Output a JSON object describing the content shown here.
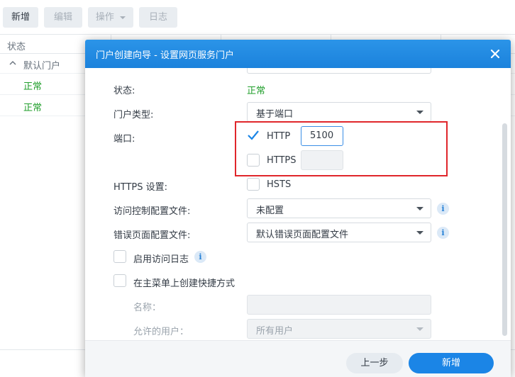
{
  "toolbar": {
    "create": "新增",
    "edit": "编辑",
    "action": "操作",
    "log": "日志"
  },
  "grid": {
    "col_status": "状态",
    "group_default": "默认门户",
    "rows": [
      "正常",
      "正常"
    ]
  },
  "dialog": {
    "title": "门户创建向导 - 设置网页服务门户",
    "fields": {
      "status_label": "状态:",
      "status_value": "正常",
      "portal_type_label": "门户类型:",
      "portal_type_value": "基于端口",
      "port_label": "端口:",
      "http_label": "HTTP",
      "http_checked": true,
      "http_port": "5100",
      "https_label": "HTTPS",
      "https_checked": false,
      "https_port": "",
      "https_settings_label": "HTTPS 设置:",
      "hsts_label": "HSTS",
      "hsts_checked": false,
      "access_profile_label": "访问控制配置文件:",
      "access_profile_value": "未配置",
      "error_page_label": "错误页面配置文件:",
      "error_page_value": "默认错误页面配置文件",
      "enable_log_label": "启用访问日志",
      "enable_log_checked": false,
      "shortcut_label": "在主菜单上创建快捷方式",
      "shortcut_checked": false,
      "name_label": "名称：",
      "name_value": "",
      "allowed_users_label": "允许的用户：",
      "allowed_users_value": "所有用户"
    },
    "buttons": {
      "back": "上一步",
      "create": "新增"
    }
  },
  "colors": {
    "accent": "#1b85e6",
    "success": "#1f9e2a",
    "highlight": "#e0262b"
  }
}
